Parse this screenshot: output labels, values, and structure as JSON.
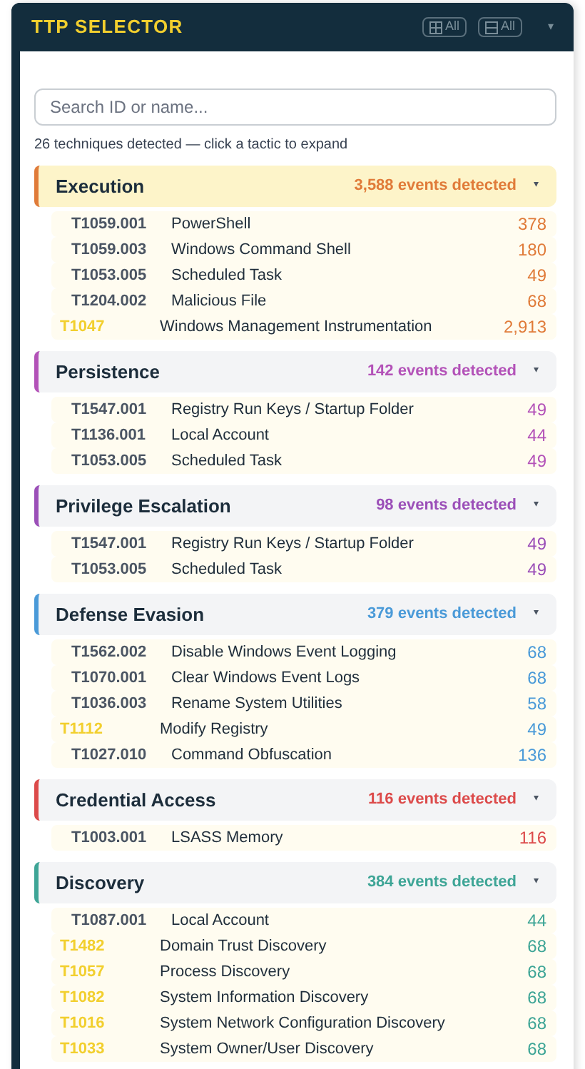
{
  "header": {
    "title": "TTP SELECTOR",
    "buttons": [
      {
        "kind": "expand",
        "label": "All"
      },
      {
        "kind": "collapse",
        "label": "All"
      }
    ],
    "menu_caret": "▾"
  },
  "search": {
    "placeholder": "Search ID or name..."
  },
  "summary": "26 techniques detected — click a tactic to expand",
  "tactics": [
    {
      "name": "Execution",
      "events": "3,588 events detected",
      "color": "#e07b39",
      "highlighted": true,
      "caret": "▾",
      "techniques": [
        {
          "kind": "sub",
          "id": "T1059.001",
          "name": "PowerShell",
          "count": "378"
        },
        {
          "kind": "sub",
          "id": "T1059.003",
          "name": "Windows Command Shell",
          "count": "180"
        },
        {
          "kind": "sub",
          "id": "T1053.005",
          "name": "Scheduled Task",
          "count": "49"
        },
        {
          "kind": "sub",
          "id": "T1204.002",
          "name": "Malicious File",
          "count": "68"
        },
        {
          "kind": "technique",
          "id": "T1047",
          "name": "Windows Management Instrumentation",
          "count": "2,913"
        }
      ]
    },
    {
      "name": "Persistence",
      "events": "142 events detected",
      "color": "#b352b8",
      "highlighted": false,
      "caret": "▾",
      "techniques": [
        {
          "kind": "sub",
          "id": "T1547.001",
          "name": "Registry Run Keys / Startup Folder",
          "count": "49"
        },
        {
          "kind": "sub",
          "id": "T1136.001",
          "name": "Local Account",
          "count": "44"
        },
        {
          "kind": "sub",
          "id": "T1053.005",
          "name": "Scheduled Task",
          "count": "49"
        }
      ]
    },
    {
      "name": "Privilege Escalation",
      "events": "98 events detected",
      "color": "#9b4fb8",
      "highlighted": false,
      "caret": "▾",
      "techniques": [
        {
          "kind": "sub",
          "id": "T1547.001",
          "name": "Registry Run Keys / Startup Folder",
          "count": "49"
        },
        {
          "kind": "sub",
          "id": "T1053.005",
          "name": "Scheduled Task",
          "count": "49"
        }
      ]
    },
    {
      "name": "Defense Evasion",
      "events": "379 events detected",
      "color": "#4a9ad8",
      "highlighted": false,
      "caret": "▾",
      "techniques": [
        {
          "kind": "sub",
          "id": "T1562.002",
          "name": "Disable Windows Event Logging",
          "count": "68"
        },
        {
          "kind": "sub",
          "id": "T1070.001",
          "name": "Clear Windows Event Logs",
          "count": "68"
        },
        {
          "kind": "sub",
          "id": "T1036.003",
          "name": "Rename System Utilities",
          "count": "58"
        },
        {
          "kind": "technique",
          "id": "T1112",
          "name": "Modify Registry",
          "count": "49"
        },
        {
          "kind": "sub",
          "id": "T1027.010",
          "name": "Command Obfuscation",
          "count": "136"
        }
      ]
    },
    {
      "name": "Credential Access",
      "events": "116 events detected",
      "color": "#dc4a4a",
      "highlighted": false,
      "caret": "▾",
      "techniques": [
        {
          "kind": "sub",
          "id": "T1003.001",
          "name": "LSASS Memory",
          "count": "116"
        }
      ]
    },
    {
      "name": "Discovery",
      "events": "384 events detected",
      "color": "#3ea596",
      "highlighted": false,
      "caret": "▾",
      "techniques": [
        {
          "kind": "sub",
          "id": "T1087.001",
          "name": "Local Account",
          "count": "44"
        },
        {
          "kind": "technique",
          "id": "T1482",
          "name": "Domain Trust Discovery",
          "count": "68"
        },
        {
          "kind": "technique",
          "id": "T1057",
          "name": "Process Discovery",
          "count": "68"
        },
        {
          "kind": "technique",
          "id": "T1082",
          "name": "System Information Discovery",
          "count": "68"
        },
        {
          "kind": "technique",
          "id": "T1016",
          "name": "System Network Configuration Discovery",
          "count": "68"
        },
        {
          "kind": "technique",
          "id": "T1033",
          "name": "System Owner/User Discovery",
          "count": "68"
        }
      ]
    }
  ]
}
